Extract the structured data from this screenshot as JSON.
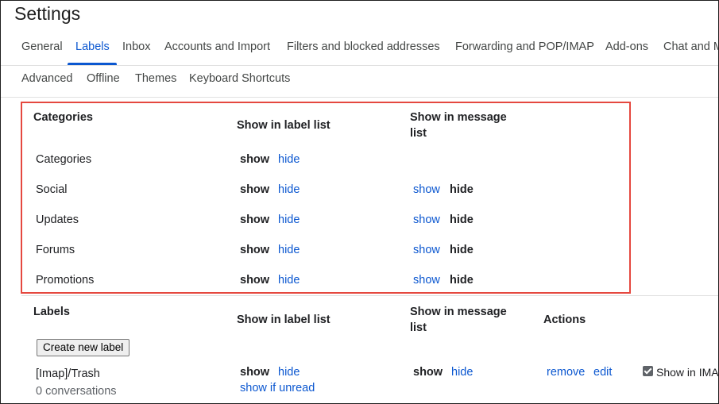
{
  "page_title": "Settings",
  "tabs_row1": [
    "General",
    "Labels",
    "Inbox",
    "Accounts and Import",
    "Filters and blocked addresses",
    "Forwarding and POP/IMAP",
    "Add-ons",
    "Chat and Meet"
  ],
  "tabs_row2": [
    "Advanced",
    "Offline",
    "Themes",
    "Keyboard Shortcuts"
  ],
  "active_tab": "Labels",
  "categories": {
    "heading": "Categories",
    "col_label_list": "Show in label list",
    "col_message_list_line1": "Show in message",
    "col_message_list_line2": "list",
    "rows": [
      {
        "name": "Categories",
        "label_show": "show",
        "label_hide": "hide",
        "msg_show": "",
        "msg_hide": ""
      },
      {
        "name": "Social",
        "label_show": "show",
        "label_hide": "hide",
        "msg_show": "show",
        "msg_hide": "hide"
      },
      {
        "name": "Updates",
        "label_show": "show",
        "label_hide": "hide",
        "msg_show": "show",
        "msg_hide": "hide"
      },
      {
        "name": "Forums",
        "label_show": "show",
        "label_hide": "hide",
        "msg_show": "show",
        "msg_hide": "hide"
      },
      {
        "name": "Promotions",
        "label_show": "show",
        "label_hide": "hide",
        "msg_show": "show",
        "msg_hide": "hide"
      }
    ]
  },
  "labels": {
    "heading": "Labels",
    "col_label_list": "Show in label list",
    "col_message_list_line1": "Show in message",
    "col_message_list_line2": "list",
    "col_actions": "Actions",
    "create_button": "Create new label",
    "rows": [
      {
        "name": "[Imap]/Trash",
        "count": "0 conversations",
        "label_show": "show",
        "label_hide": "hide",
        "label_show_if_unread": "show if unread",
        "msg_show": "show",
        "msg_hide": "hide",
        "remove": "remove",
        "edit": "edit",
        "imap_label": "Show in IMAP",
        "imap_checked": true
      }
    ]
  },
  "colors": {
    "accent": "#0b57d0",
    "highlight": "#e5483f"
  }
}
